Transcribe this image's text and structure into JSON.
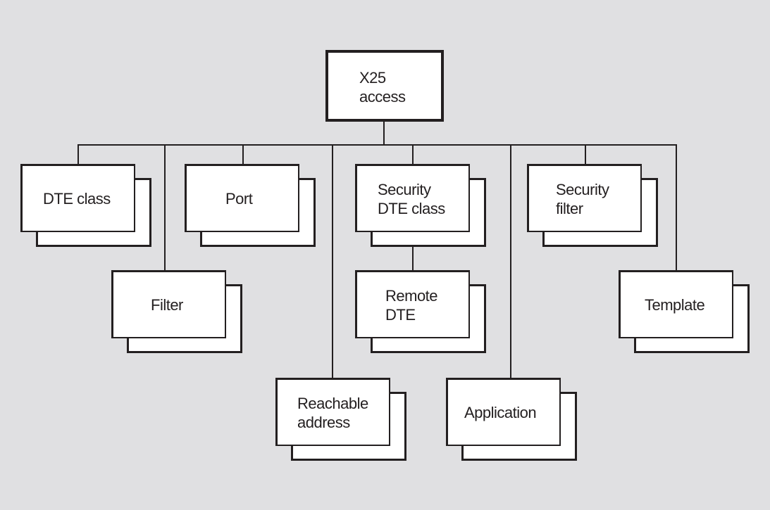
{
  "diagram": {
    "type": "hierarchy",
    "root": {
      "id": "x25-access",
      "lines": [
        "X25",
        "access"
      ]
    },
    "nodes": [
      {
        "id": "dte-class",
        "lines": [
          "DTE class"
        ],
        "parent": "x25-access"
      },
      {
        "id": "filter",
        "lines": [
          "Filter"
        ],
        "parent": "x25-access"
      },
      {
        "id": "port",
        "lines": [
          "Port"
        ],
        "parent": "x25-access"
      },
      {
        "id": "reachable-address",
        "lines": [
          "Reachable",
          "address"
        ],
        "parent": "x25-access"
      },
      {
        "id": "security-dte-class",
        "lines": [
          "Security",
          "DTE class"
        ],
        "parent": "x25-access"
      },
      {
        "id": "remote-dte",
        "lines": [
          "Remote",
          "DTE"
        ],
        "parent": "security-dte-class"
      },
      {
        "id": "application",
        "lines": [
          "Application"
        ],
        "parent": "x25-access"
      },
      {
        "id": "security-filter",
        "lines": [
          "Security",
          "filter"
        ],
        "parent": "x25-access"
      },
      {
        "id": "template",
        "lines": [
          "Template"
        ],
        "parent": "x25-access"
      }
    ],
    "colors": {
      "background": "#e0e0e2",
      "box": "#ffffff",
      "stroke": "#231f20"
    }
  }
}
